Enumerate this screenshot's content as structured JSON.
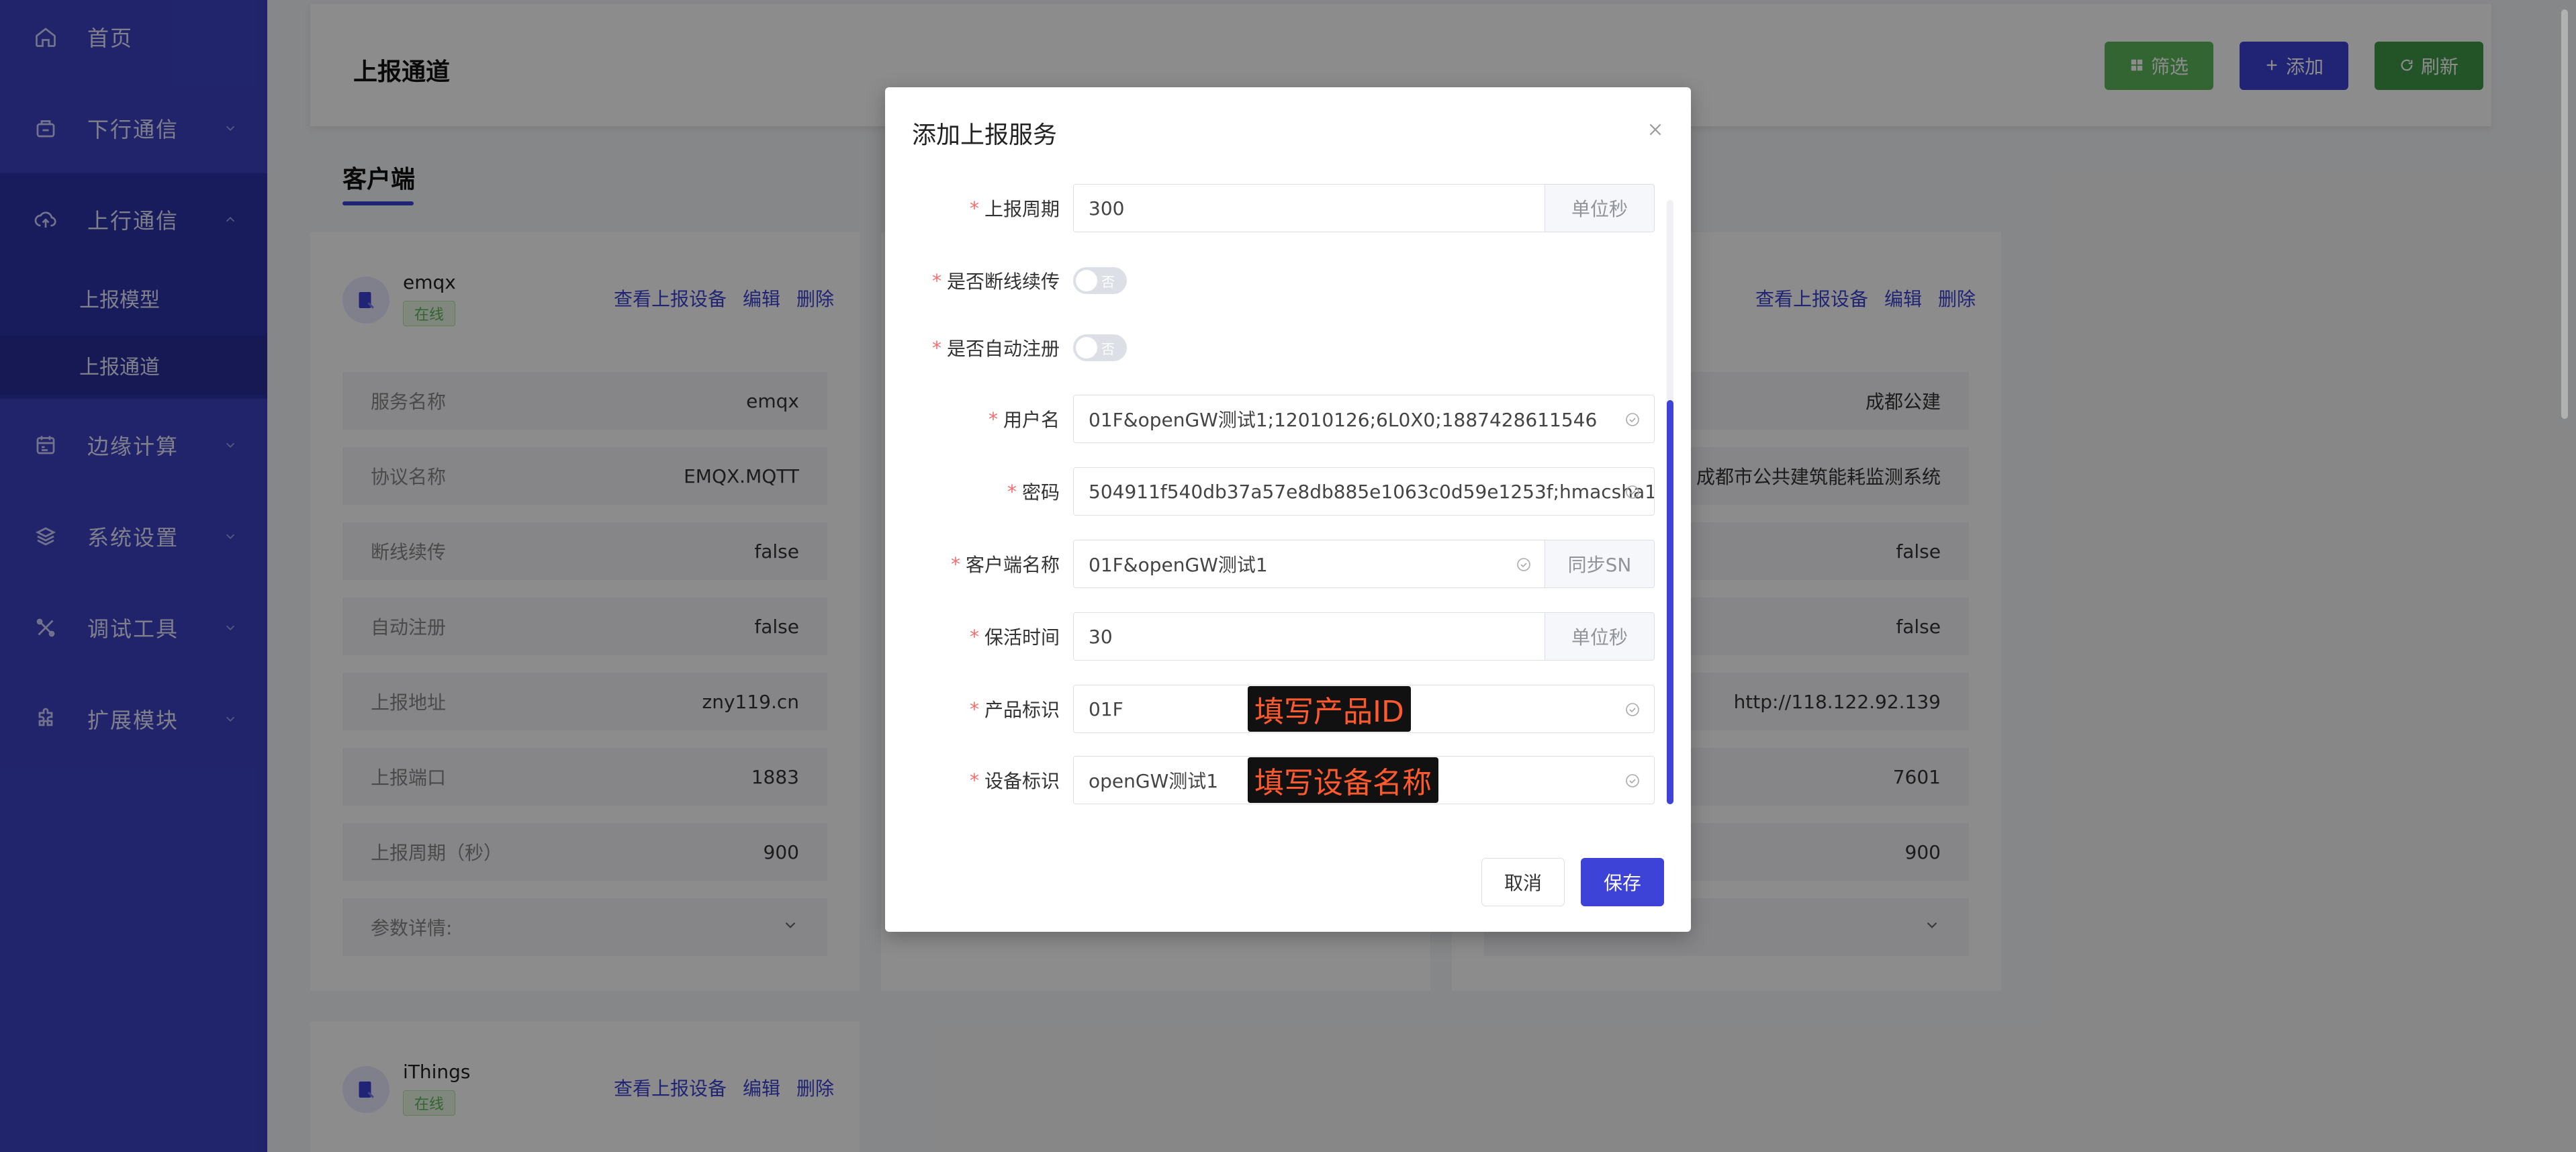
{
  "sidebar": {
    "items": [
      {
        "label": "首页",
        "icon": "home-icon"
      },
      {
        "label": "下行通信",
        "icon": "downlink-icon"
      },
      {
        "label": "上行通信",
        "icon": "cloud-upload-icon"
      },
      {
        "label": "边缘计算",
        "icon": "calendar-icon"
      },
      {
        "label": "系统设置",
        "icon": "layers-icon"
      },
      {
        "label": "调试工具",
        "icon": "tools-icon"
      },
      {
        "label": "扩展模块",
        "icon": "puzzle-icon"
      }
    ],
    "subitems": [
      {
        "label": "上报模型"
      },
      {
        "label": "上报通道"
      }
    ]
  },
  "header": {
    "title": "上报通道",
    "filter_label": "筛选",
    "add_label": "添加",
    "refresh_label": "刷新"
  },
  "section": {
    "title": "客户端"
  },
  "cards": [
    {
      "name": "emqx",
      "status": "在线",
      "links": [
        "查看上报设备",
        "编辑",
        "删除"
      ],
      "rows": [
        {
          "k": "服务名称",
          "v": "emqx"
        },
        {
          "k": "协议名称",
          "v": "EMQX.MQTT"
        },
        {
          "k": "断线续传",
          "v": "false"
        },
        {
          "k": "自动注册",
          "v": "false"
        },
        {
          "k": "上报地址",
          "v": "zny119.cn"
        },
        {
          "k": "上报端口",
          "v": "1883"
        },
        {
          "k": "上报周期（秒）",
          "v": "900"
        },
        {
          "k": "参数详情:",
          "v": ""
        }
      ]
    },
    {
      "links": [
        "查看上报设备",
        "编辑",
        "删除"
      ],
      "rows": [
        {
          "v": "成都公建"
        },
        {
          "v": "成都市公共建筑能耗监测系统"
        },
        {
          "v": "false"
        },
        {
          "v": "false"
        },
        {
          "v": "http://118.122.92.139"
        },
        {
          "v": "7601"
        },
        {
          "v": "900"
        }
      ]
    },
    {
      "name": "iThings",
      "status": "在线",
      "links": [
        "查看上报设备",
        "编辑",
        "删除"
      ]
    }
  ],
  "modal": {
    "title": "添加上报服务",
    "fields": {
      "period": {
        "label": "上报周期",
        "value": "300",
        "addon": "单位秒"
      },
      "resume": {
        "label": "是否断线续传",
        "switch_text": "否"
      },
      "autoreg": {
        "label": "是否自动注册",
        "switch_text": "否"
      },
      "username": {
        "label": "用户名",
        "value": "01F&openGW测试1;12010126;6L0X0;1887428611546"
      },
      "password": {
        "label": "密码",
        "value": "504911f540db37a57e8db885e1063c0d59e1253f;hmacsha1"
      },
      "client": {
        "label": "客户端名称",
        "value": "01F&openGW测试1",
        "addon": "同步SN"
      },
      "keepalive": {
        "label": "保活时间",
        "value": "30",
        "addon": "单位秒"
      },
      "product": {
        "label": "产品标识",
        "value": "01F",
        "hint": "填写产品ID"
      },
      "device": {
        "label": "设备标识",
        "value": "openGW测试1",
        "hint": "填写设备名称"
      }
    },
    "cancel_label": "取消",
    "save_label": "保存"
  },
  "colors": {
    "sidebar": "#3d43c4",
    "accent": "#3d43d6",
    "filter": "#5cb85c",
    "refresh": "#3e9a4a",
    "required": "#f56c6c",
    "hint_text": "#ff5a2d"
  }
}
